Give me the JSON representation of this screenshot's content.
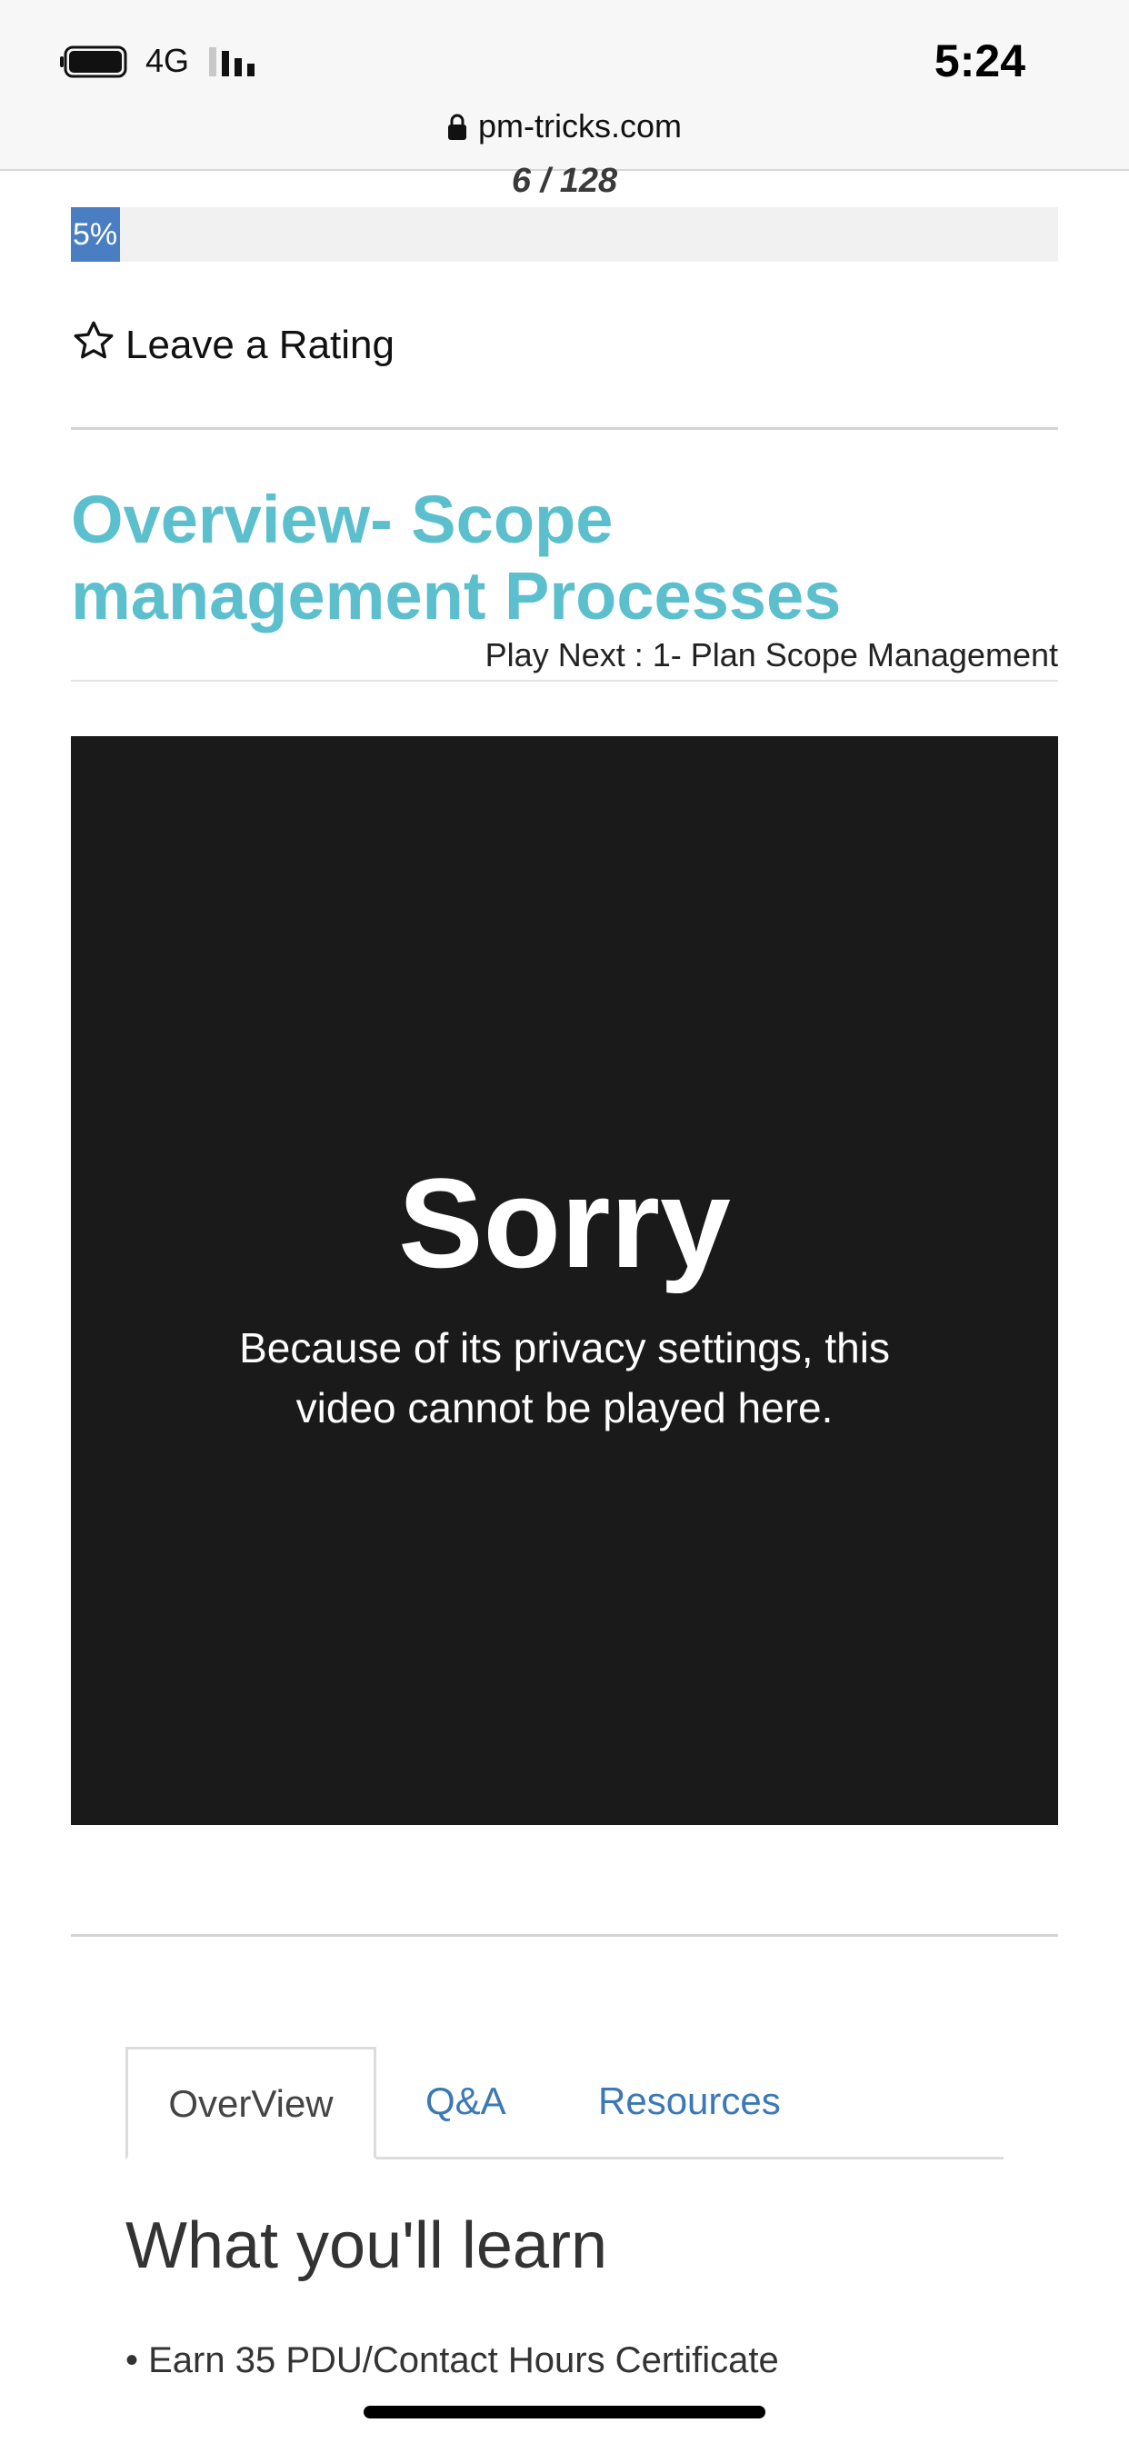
{
  "status_bar": {
    "network": "4G",
    "time": "5:24"
  },
  "browser": {
    "url": "pm-tricks.com"
  },
  "course": {
    "counter": "6 / 128",
    "progress_label": "5%",
    "progress_percent": 5,
    "rating_label": "Leave a Rating",
    "lesson_title": "Overview- Scope management Processes",
    "play_next": "Play Next : 1- Plan Scope Management"
  },
  "video": {
    "heading": "Sorry",
    "message": "Because of its privacy settings, this video cannot be played here."
  },
  "tabs": [
    {
      "label": "OverView",
      "active": true
    },
    {
      "label": "Q&A",
      "active": false
    },
    {
      "label": "Resources",
      "active": false
    }
  ],
  "learn": {
    "heading": "What you'll learn",
    "items": [
      "Earn 35 PDU/Contact Hours Certificate"
    ]
  },
  "colors": {
    "title": "#5bbfcd",
    "progress": "#4a7ec2",
    "tab_link": "#3a78b6",
    "video_bg": "#1a1a1b"
  }
}
